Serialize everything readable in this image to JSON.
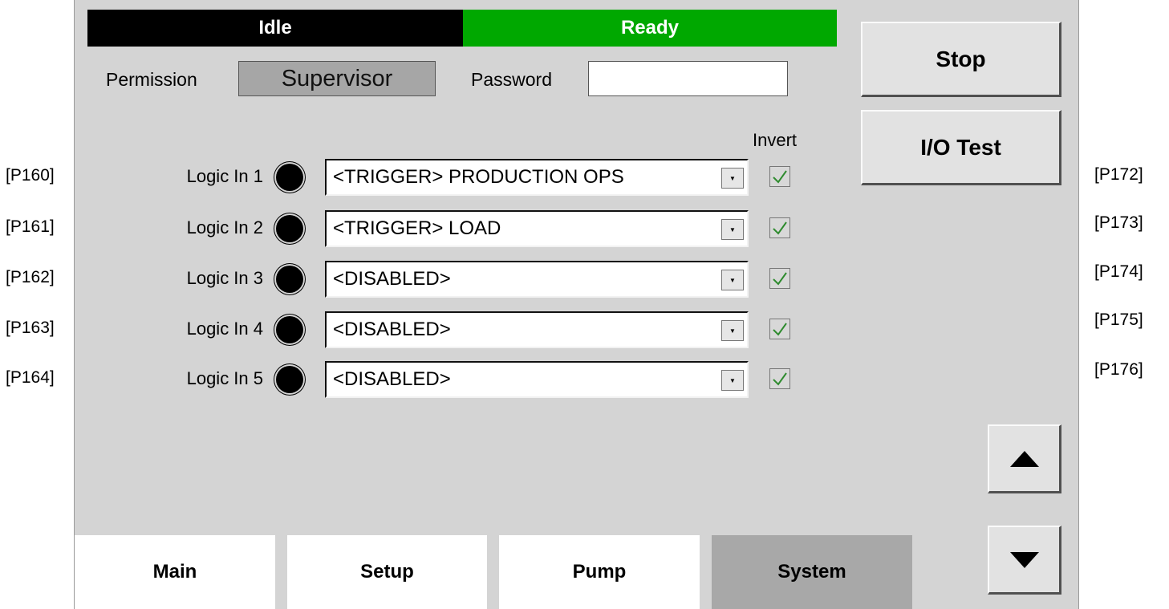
{
  "status": {
    "left": "Idle",
    "right": "Ready"
  },
  "colors": {
    "idle_bg": "#000000",
    "ready_bg": "#00a800",
    "panel_bg": "#d4d4d4",
    "active_tab": "#a8a8a8"
  },
  "permission": {
    "label": "Permission",
    "value": "Supervisor"
  },
  "password": {
    "label": "Password",
    "value": ""
  },
  "buttons": {
    "stop": "Stop",
    "io_test": "I/O Test"
  },
  "invert_header": "Invert",
  "left_tags": [
    "[P160]",
    "[P161]",
    "[P162]",
    "[P163]",
    "[P164]"
  ],
  "right_tags": [
    "[P172]",
    "[P173]",
    "[P174]",
    "[P175]",
    "[P176]"
  ],
  "inputs": [
    {
      "label": "Logic In 1",
      "led": "off",
      "selection": "<TRIGGER> PRODUCTION OPS",
      "invert": true
    },
    {
      "label": "Logic In 2",
      "led": "off",
      "selection": "<TRIGGER> LOAD",
      "invert": true
    },
    {
      "label": "Logic In 3",
      "led": "off",
      "selection": "<DISABLED>",
      "invert": true
    },
    {
      "label": "Logic In 4",
      "led": "off",
      "selection": "<DISABLED>",
      "invert": true
    },
    {
      "label": "Logic In 5",
      "led": "off",
      "selection": "<DISABLED>",
      "invert": true
    }
  ],
  "icons": {
    "scroll_up": "triangle-up-icon",
    "scroll_down": "triangle-down-icon",
    "dropdown": "dropdown-arrow-icon",
    "check": "checkmark-icon"
  },
  "tabs": [
    {
      "label": "Main",
      "active": false
    },
    {
      "label": "Setup",
      "active": false
    },
    {
      "label": "Pump",
      "active": false
    },
    {
      "label": "System",
      "active": true
    }
  ]
}
